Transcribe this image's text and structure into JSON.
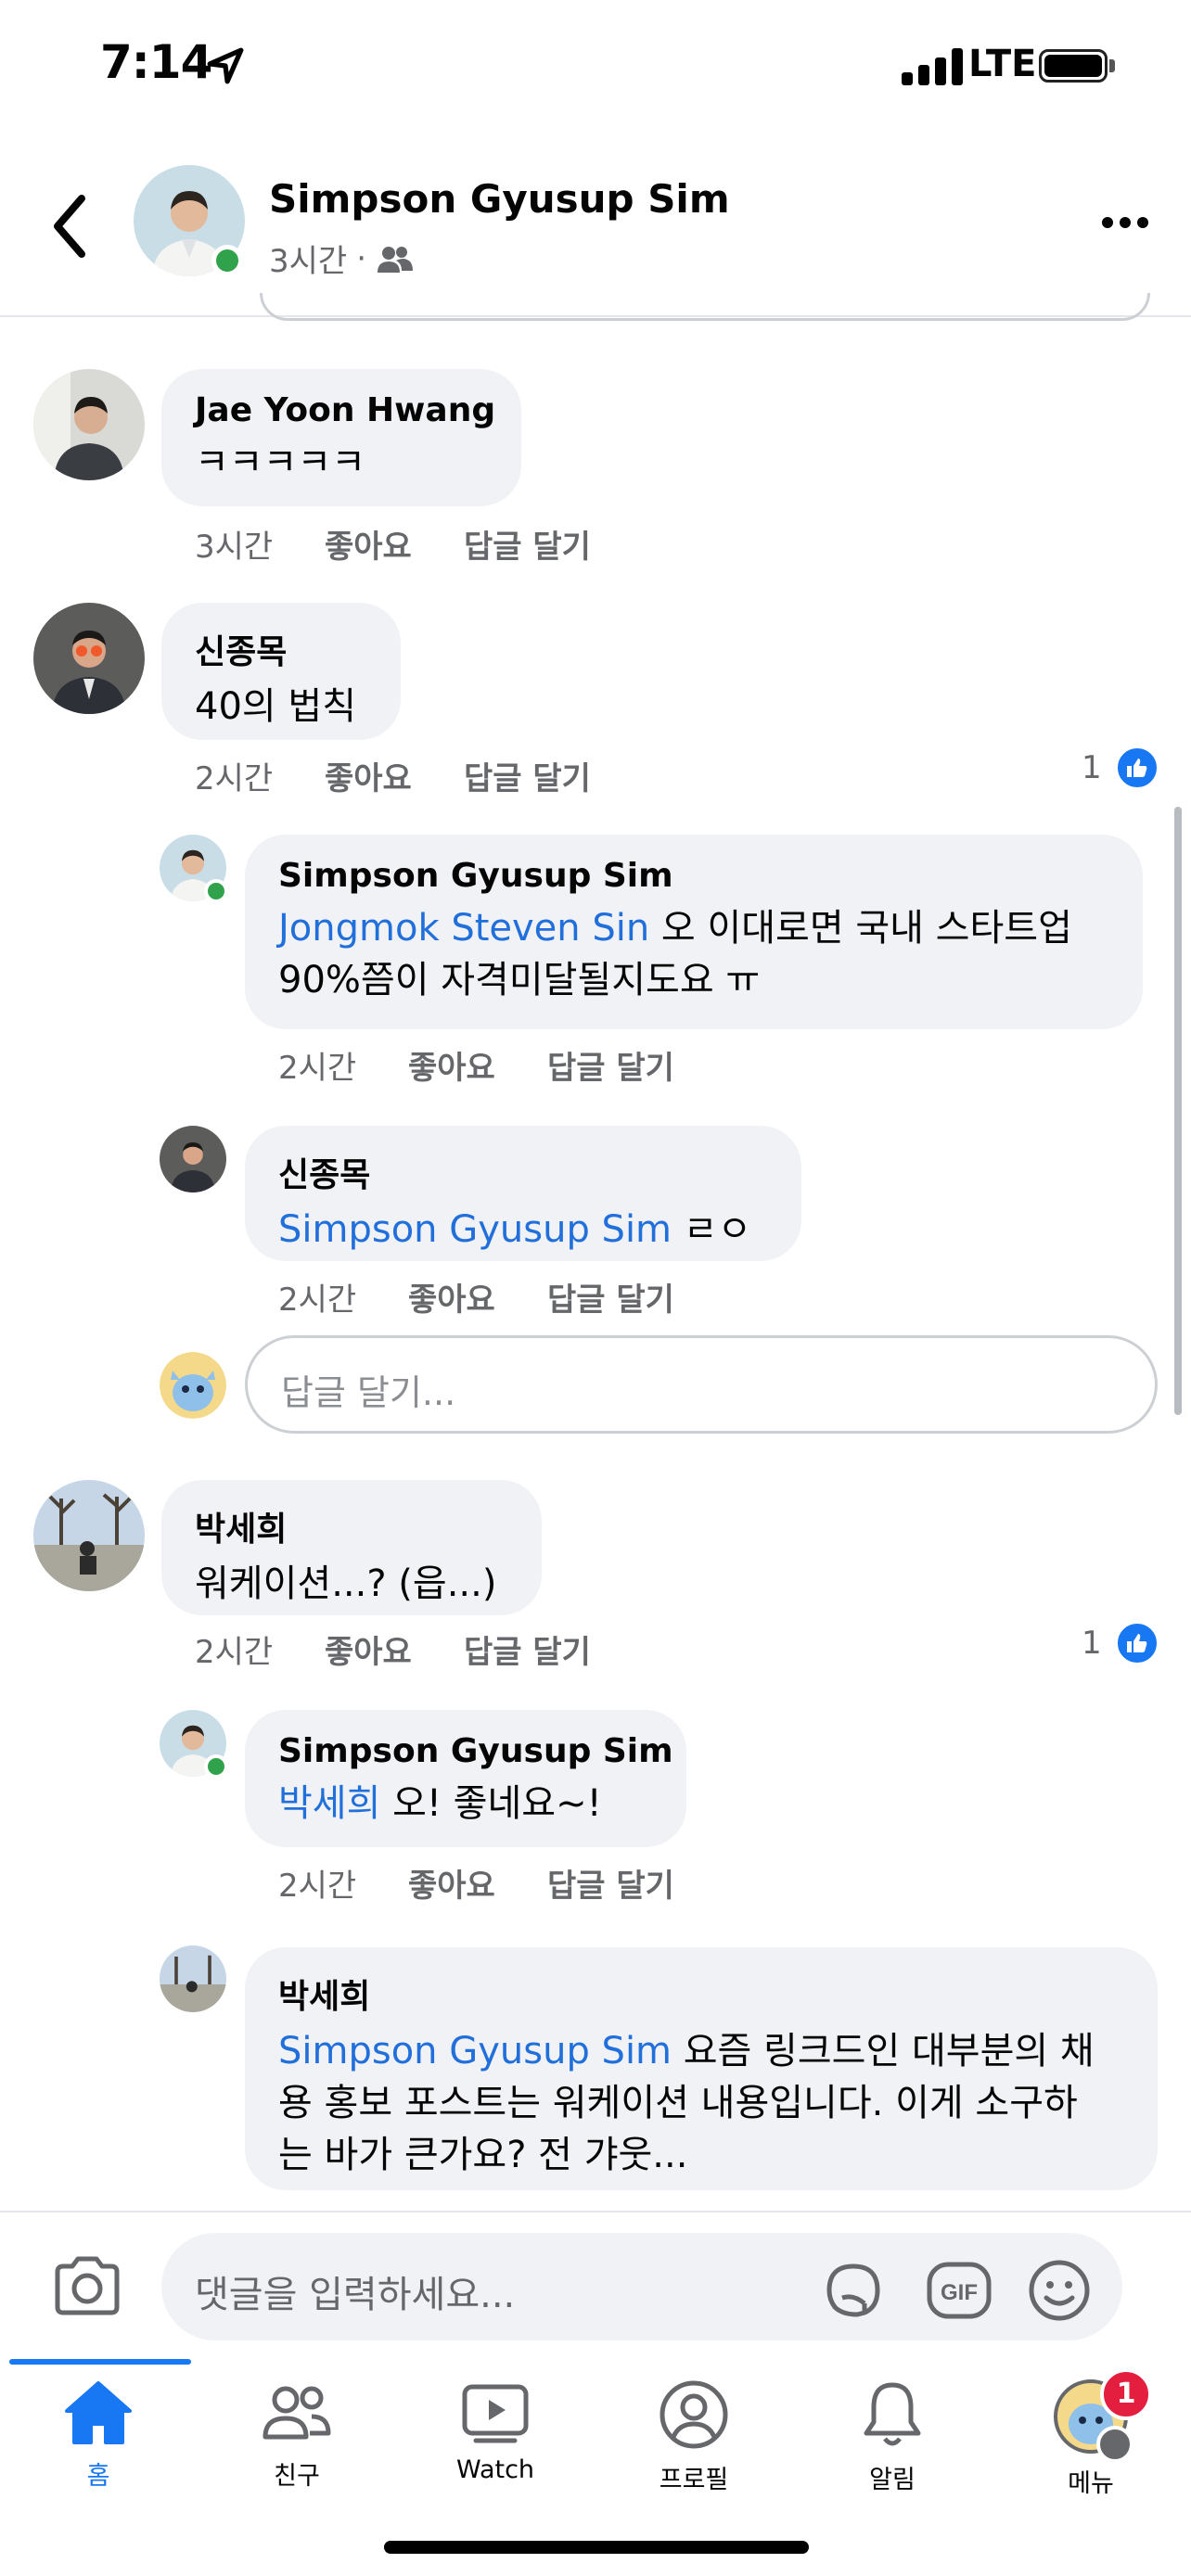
{
  "status_bar": {
    "time": "7:14",
    "network": "LTE"
  },
  "header": {
    "name": "Simpson Gyusup Sim",
    "time": "3시간",
    "separator": "·",
    "audience_icon": "friends-icon"
  },
  "comments": [
    {
      "author": "Jae Yoon Hwang",
      "text": "ㅋㅋㅋㅋㅋ",
      "time": "3시간",
      "like": "좋아요",
      "reply": "답글 달기"
    },
    {
      "author": "신종목",
      "text": "40의 법칙",
      "time": "2시간",
      "like": "좋아요",
      "reply": "답글 달기",
      "like_count": "1"
    },
    {
      "author": "Simpson Gyusup Sim",
      "mention": "Jongmok Steven Sin",
      "text_line1": " 오 이대로면 국내 스타트업",
      "text_line2": "90%쯤이 자격미달될지도요 ㅠ",
      "time": "2시간",
      "like": "좋아요",
      "reply": "답글 달기"
    },
    {
      "author": "신종목",
      "mention": "Simpson Gyusup Sim",
      "text": " ㄹㅇ",
      "time": "2시간",
      "like": "좋아요",
      "reply": "답글 달기"
    },
    {
      "author": "박세희",
      "text": "워케이션...? (읍...)",
      "time": "2시간",
      "like": "좋아요",
      "reply": "답글 달기",
      "like_count": "1"
    },
    {
      "author": "Simpson Gyusup Sim",
      "mention": "박세희",
      "text": " 오! 좋네요~!",
      "time": "2시간",
      "like": "좋아요",
      "reply": "답글 달기"
    },
    {
      "author": "박세희",
      "mention": "Simpson Gyusup Sim",
      "text_line1": " 요즘 링크드인 대부분의 채",
      "text_line2": "용 홍보 포스트는 워케이션 내용입니다. 이게 소구하",
      "text_line3": "는 바가 큰가요? 전 갸웃..."
    }
  ],
  "reply_input": {
    "placeholder": "답글 달기..."
  },
  "composer": {
    "placeholder": "댓글을 입력하세요...",
    "icons": [
      "camera-icon",
      "sticker-icon",
      "gif-icon",
      "emoji-icon"
    ]
  },
  "tabs": [
    {
      "label": "홈",
      "icon": "home-icon",
      "active": true
    },
    {
      "label": "친구",
      "icon": "friends-icon"
    },
    {
      "label": "Watch",
      "icon": "watch-icon"
    },
    {
      "label": "프로필",
      "icon": "profile-icon"
    },
    {
      "label": "알림",
      "icon": "bell-icon"
    },
    {
      "label": "메뉴",
      "icon": "menu-icon",
      "badge": "1"
    }
  ],
  "colors": {
    "accent": "#1877f2",
    "mention": "#216fdb",
    "bubble": "#f0f2f5",
    "online": "#31a24c",
    "badge": "#e41e3f"
  }
}
